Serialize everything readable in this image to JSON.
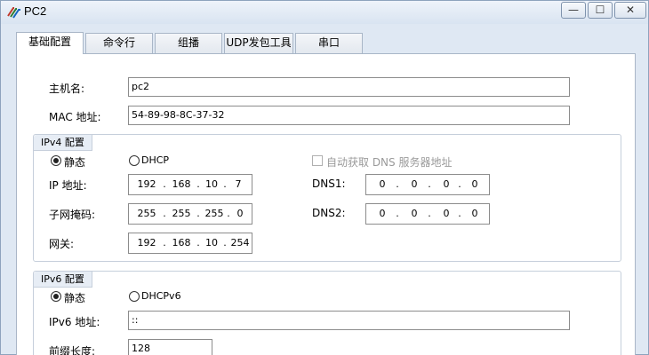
{
  "window": {
    "title": "PC2",
    "min_label": "—",
    "max_label": "☐",
    "close_label": "✕"
  },
  "tabs": [
    "基础配置",
    "命令行",
    "组播",
    "UDP发包工具",
    "串口"
  ],
  "basic": {
    "hostname_label": "主机名:",
    "hostname_value": "pc2",
    "mac_label": "MAC 地址:",
    "mac_value": "54-89-98-8C-37-32"
  },
  "ipv4": {
    "group_label": "IPv4 配置",
    "static_label": "静态",
    "dhcp_label": "DHCP",
    "auto_dns_label": "自动获取 DNS 服务器地址",
    "ip_label": "IP 地址:",
    "ip": [
      "192",
      "168",
      "10",
      "7"
    ],
    "mask_label": "子网掩码:",
    "mask": [
      "255",
      "255",
      "255",
      "0"
    ],
    "gateway_label": "网关:",
    "gateway": [
      "192",
      "168",
      "10",
      "254"
    ],
    "dns1_label": "DNS1:",
    "dns1": [
      "0",
      "0",
      "0",
      "0"
    ],
    "dns2_label": "DNS2:",
    "dns2": [
      "0",
      "0",
      "0",
      "0"
    ],
    "mode": "static"
  },
  "ipv6": {
    "group_label": "IPv6 配置",
    "static_label": "静态",
    "dhcp_label": "DHCPv6",
    "ip_label": "IPv6 地址:",
    "ip_value": "::",
    "prefix_label": "前缀长度:",
    "prefix_value": "128",
    "mode": "static"
  },
  "colors": {
    "window_bg": "#dfe8f3",
    "group_header": "#e7edf5",
    "border": "#a9b6c7"
  },
  "icons": {
    "app": "ensp-pc-icon"
  }
}
